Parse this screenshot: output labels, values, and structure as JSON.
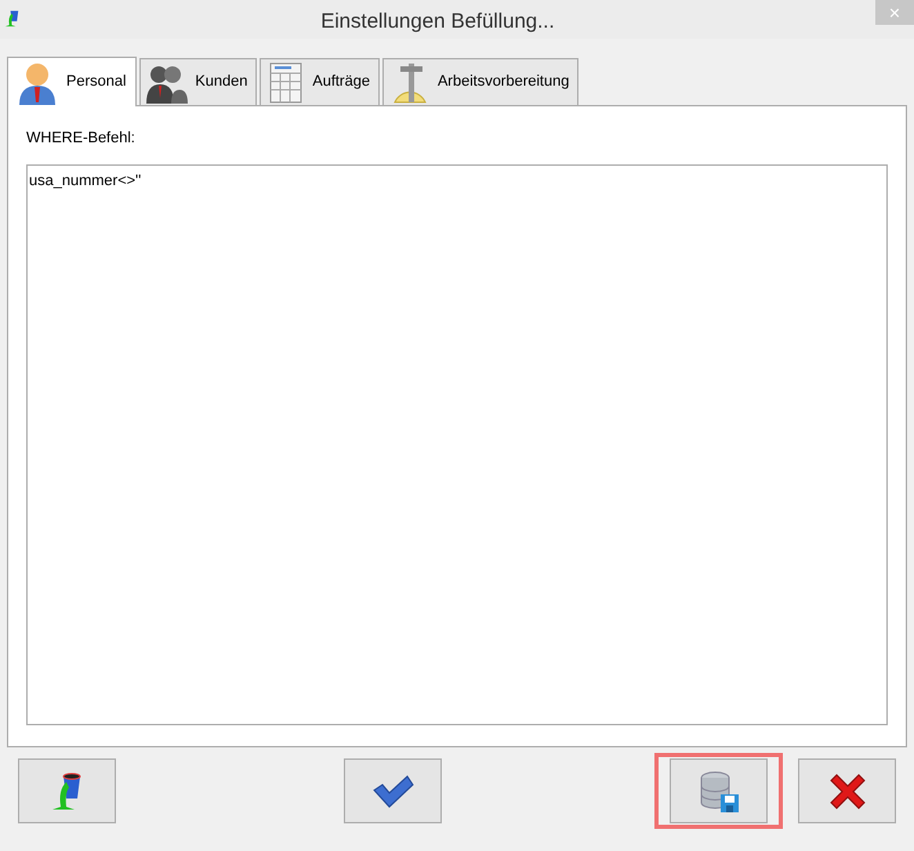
{
  "window": {
    "title": "Einstellungen Befüllung...",
    "close": "×"
  },
  "tabs": [
    {
      "label": "Personal",
      "selected": true,
      "kind": "person"
    },
    {
      "label": "Kunden",
      "selected": false,
      "kind": "group"
    },
    {
      "label": "Aufträge",
      "selected": false,
      "kind": "table"
    },
    {
      "label": "Arbeitsvorbereitung",
      "selected": false,
      "kind": "caliper"
    }
  ],
  "where_label": "WHERE-Befehl:",
  "where_field": {
    "value": "usa_nummer<>''"
  },
  "buttons": [
    {
      "kind": "fill",
      "highlighted": false
    },
    {
      "kind": "ok",
      "highlighted": false
    },
    {
      "kind": "save",
      "highlighted": true
    },
    {
      "kind": "cancel",
      "highlighted": false
    }
  ]
}
